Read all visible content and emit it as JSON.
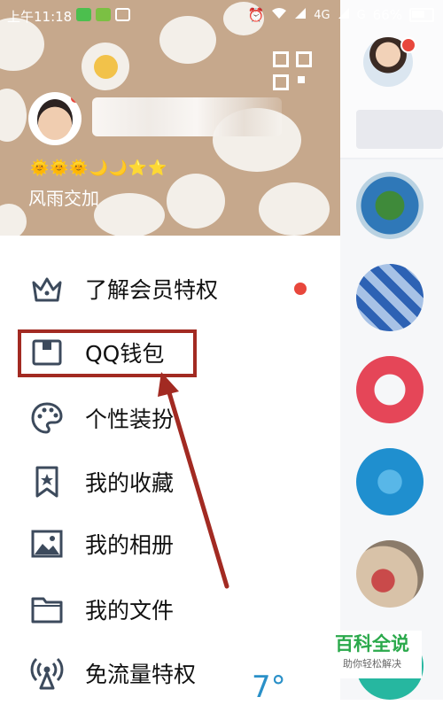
{
  "statusbar": {
    "time": "上午11:18",
    "network_4g": "4G",
    "network_g": "G",
    "battery": "66%"
  },
  "profile": {
    "level_icons": "🌞🌞🌞🌙🌙⭐⭐",
    "signature": "风雨交加"
  },
  "menu": {
    "items": [
      {
        "label": "了解会员特权",
        "icon": "crown-icon",
        "has_badge": true
      },
      {
        "label": "QQ钱包",
        "icon": "wallet-icon",
        "has_badge": false
      },
      {
        "label": "个性装扮",
        "icon": "palette-icon",
        "has_badge": false
      },
      {
        "label": "我的收藏",
        "icon": "bookmark-icon",
        "has_badge": false
      },
      {
        "label": "我的相册",
        "icon": "photo-icon",
        "has_badge": false
      },
      {
        "label": "我的文件",
        "icon": "folder-icon",
        "has_badge": false
      },
      {
        "label": "免流量特权",
        "icon": "antenna-icon",
        "has_badge": false
      }
    ]
  },
  "weather": {
    "temperature": "7°"
  },
  "watermark": {
    "title": "百科全说",
    "subtitle": "助你轻松解决"
  },
  "colors": {
    "accent_red": "#e8473c",
    "annotation_red": "#a22a22",
    "header_bg": "#c6a88c",
    "icon_color": "#3c4a5c"
  }
}
